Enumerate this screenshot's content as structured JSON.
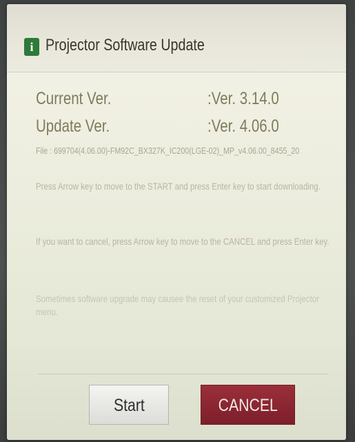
{
  "dialog": {
    "title_icon_glyph": "i",
    "title": "Projector Software Update"
  },
  "versions": {
    "current_label": "Current Ver.",
    "current_value": ":Ver.  3.14.0",
    "update_label": "Update Ver.",
    "update_value": ":Ver.  4.06.0"
  },
  "file_line": "File : 699704(4.06.00)-FM92C_BX327K_IC200(LGE-02)_MP_v4.06.00_8455_20",
  "instructions": [
    "Press Arrow key to move to the START and press Enter key to start downloading.",
    "If you want to cancel, press Arrow key to move to the CANCEL and press Enter key.",
    "Sometimes software upgrade may causee the reset of your customized Projector menu."
  ],
  "buttons": {
    "start_label": "Start",
    "cancel_label": "CANCEL"
  },
  "colors": {
    "dialog_background": "#eeeee0",
    "title_icon": "#2d7a3a",
    "cancel_button": "#8b2732",
    "start_button": "#e8e8e5"
  }
}
